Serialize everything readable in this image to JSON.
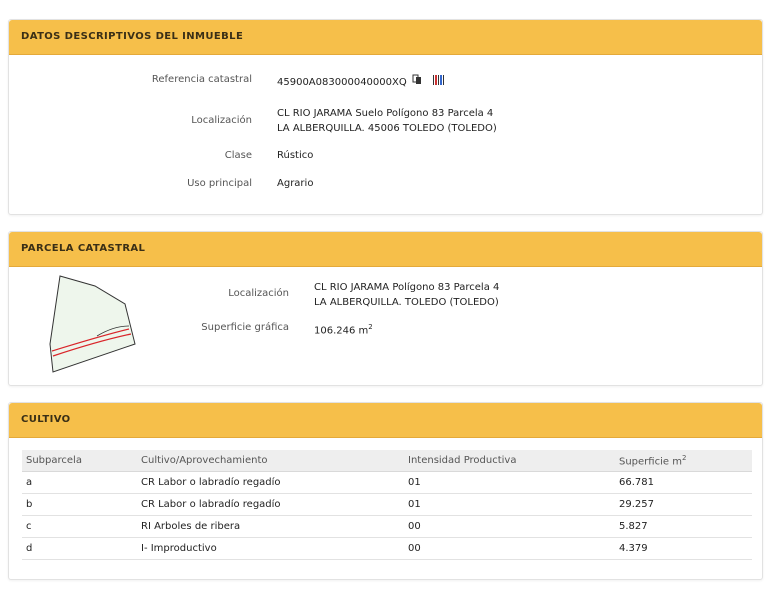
{
  "descriptive": {
    "title": "DATOS DESCRIPTIVOS DEL INMUEBLE",
    "ref_label": "Referencia catastral",
    "ref_value": "45900A083000040000XQ",
    "loc_label": "Localización",
    "loc_line1": "CL RIO JARAMA Suelo Polígono 83 Parcela 4",
    "loc_line2": "LA ALBERQUILLA. 45006 TOLEDO (TOLEDO)",
    "class_label": "Clase",
    "class_value": "Rústico",
    "use_label": "Uso principal",
    "use_value": "Agrario"
  },
  "parcel": {
    "title": "PARCELA CATASTRAL",
    "loc_label": "Localización",
    "loc_line1": "CL RIO JARAMA Polígono 83 Parcela 4",
    "loc_line2": "LA ALBERQUILLA. TOLEDO (TOLEDO)",
    "surface_label": "Superficie gráfica",
    "surface_value": "106.246 m",
    "surface_unit_sup": "2"
  },
  "crops": {
    "title": "CULTIVO",
    "headers": [
      "Subparcela",
      "Cultivo/Aprovechamiento",
      "Intensidad Productiva",
      "Superficie m"
    ],
    "header_sup": "2",
    "rows": [
      [
        "a",
        "CR Labor o labradío regadío",
        "01",
        "66.781"
      ],
      [
        "b",
        "CR Labor o labradío regadío",
        "01",
        "29.257"
      ],
      [
        "c",
        "RI Arboles de ribera",
        "00",
        "5.827"
      ],
      [
        "d",
        "I- Improductivo",
        "00",
        "4.379"
      ]
    ]
  },
  "colors": {
    "header_bg": "#f6bf4a",
    "river_line": "#d9252a",
    "parcel_fill": "#eef6ec"
  },
  "icons": [
    "copy-icon",
    "barcode-icon"
  ]
}
